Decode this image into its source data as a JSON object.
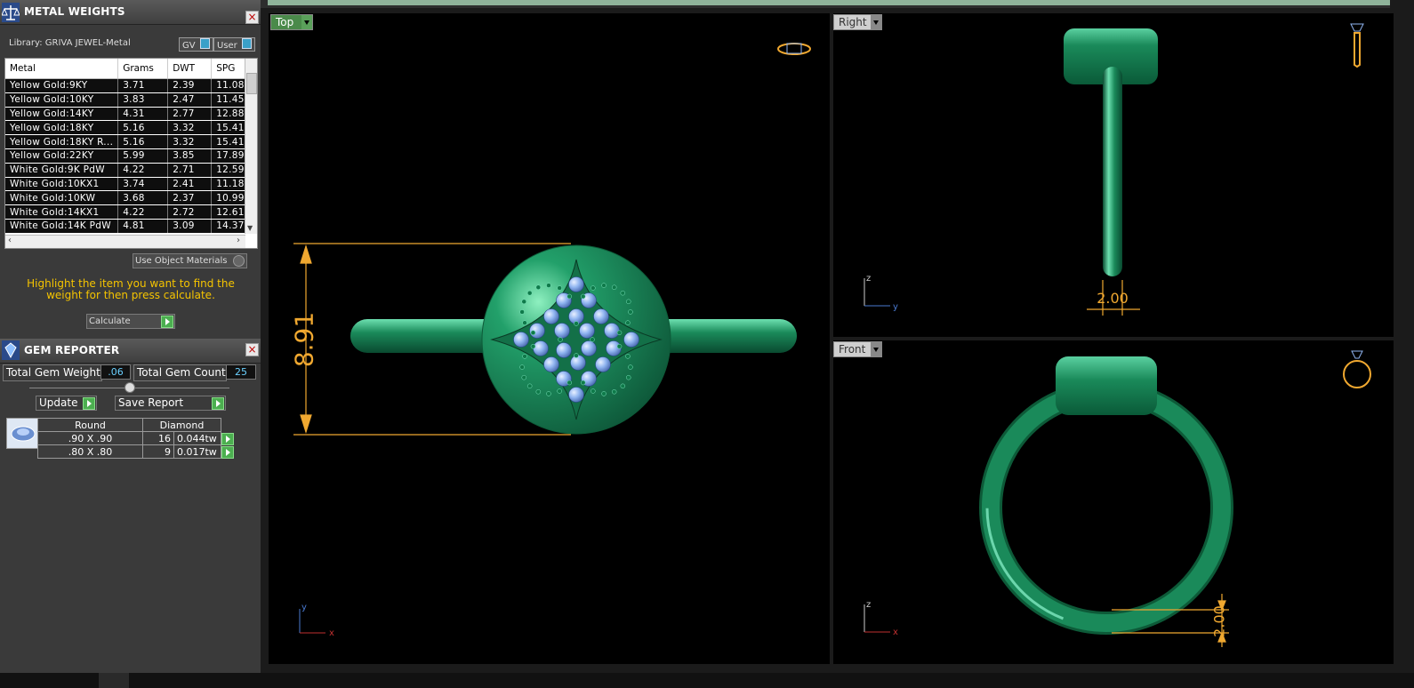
{
  "metal_weights": {
    "title": "METAL WEIGHTS",
    "library": "Library: GRIVA JEWEL-Metal",
    "toggle_gv": "GV",
    "toggle_user": "User",
    "columns": [
      "Metal",
      "Grams",
      "DWT",
      "SPG"
    ],
    "rows": [
      [
        "Yellow Gold:9KY",
        "3.71",
        "2.39",
        "11.08"
      ],
      [
        "Yellow Gold:10KY",
        "3.83",
        "2.47",
        "11.45"
      ],
      [
        "Yellow Gold:14KY",
        "4.31",
        "2.77",
        "12.88"
      ],
      [
        "Yellow Gold:18KY",
        "5.16",
        "3.32",
        "15.41"
      ],
      [
        "Yellow Gold:18KY R...",
        "5.16",
        "3.32",
        "15.41"
      ],
      [
        "Yellow Gold:22KY",
        "5.99",
        "3.85",
        "17.89"
      ],
      [
        "White Gold:9K PdW",
        "4.22",
        "2.71",
        "12.59"
      ],
      [
        "White Gold:10KX1",
        "3.74",
        "2.41",
        "11.18"
      ],
      [
        "White Gold:10KW",
        "3.68",
        "2.37",
        "10.99"
      ],
      [
        "White Gold:14KX1",
        "4.22",
        "2.72",
        "12.61"
      ],
      [
        "White Gold:14K PdW",
        "4.81",
        "3.09",
        "14.37"
      ]
    ],
    "use_object_materials": "Use Object Materials",
    "hint": "Highlight the item you want to find the weight for then press calculate.",
    "calculate": "Calculate"
  },
  "gem_reporter": {
    "title": "GEM REPORTER",
    "total_weight_label": "Total Gem Weight",
    "total_weight_value": ".06",
    "total_count_label": "Total Gem Count",
    "total_count_value": "25",
    "update": "Update",
    "save_report": "Save Report",
    "header": [
      "Round",
      "Diamond"
    ],
    "rows": [
      [
        ".90 X .90",
        "16",
        "0.044tw"
      ],
      [
        ".80 X .80",
        "9",
        "0.017tw"
      ]
    ]
  },
  "viewports": {
    "top": {
      "label": "Top",
      "dimension": "8.91",
      "axis_y": "y",
      "axis_x": "x"
    },
    "right": {
      "label": "Right",
      "dimension": "2.00",
      "axis_v": "z",
      "axis_h": "y"
    },
    "front": {
      "label": "Front",
      "dimension": "2.00",
      "axis_v": "z",
      "axis_h": "x"
    }
  },
  "colors": {
    "ring": "#1a8a5a",
    "dimension": "#f0a830",
    "gem": "#8fb4f0",
    "accent": "#4caf50"
  }
}
